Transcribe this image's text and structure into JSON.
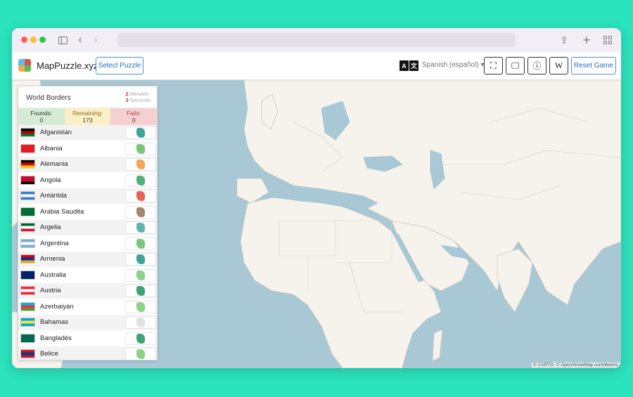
{
  "app": {
    "title": "MapPuzzle.xyz",
    "select_label": "Select Puzzle",
    "lang_glyphs": [
      "A",
      "文"
    ],
    "language": "Spanish (español) ▾",
    "reset_label": "Reset Game",
    "wiki_glyph": "W",
    "info_glyph": "ⓘ",
    "fullscreen_glyph": "⛶",
    "monitor_glyph": "🖵"
  },
  "browser": {
    "back_glyph": "‹",
    "forward_glyph": "›",
    "share_glyph": "⇪",
    "plus_glyph": "+"
  },
  "panel": {
    "title": "World Borders",
    "timer": {
      "minutes": "2",
      "minutes_label": "Minutes",
      "seconds": "3",
      "seconds_label": "Seconds"
    },
    "found_label": "Founds:",
    "found_value": "0",
    "remaining_label": "Remaining:",
    "remaining_value": "173",
    "fails_label": "Fails:",
    "fails_value": "0"
  },
  "countries": [
    {
      "name": "Afganistán",
      "flag": [
        "#000000",
        "#be0000",
        "#007a36"
      ],
      "shape_color": "#3fa39a"
    },
    {
      "name": "Albania",
      "flag": [
        "#e41e20",
        "#e41e20",
        "#e41e20"
      ],
      "shape_color": "#7cc47a"
    },
    {
      "name": "Alemania",
      "flag": [
        "#000000",
        "#dd0000",
        "#ffce00"
      ],
      "shape_color": "#f0a85a"
    },
    {
      "name": "Angola",
      "flag": [
        "#cc092f",
        "#cc092f",
        "#000000"
      ],
      "shape_color": "#52b07e"
    },
    {
      "name": "Antártida",
      "flag": [
        "#3a7dce",
        "#ffffff",
        "#3a7dce"
      ],
      "shape_color": "#e8605a"
    },
    {
      "name": "Arabia Saudita",
      "flag": [
        "#006c35",
        "#006c35",
        "#006c35"
      ],
      "shape_color": "#a4866a"
    },
    {
      "name": "Argelia",
      "flag": [
        "#006233",
        "#ffffff",
        "#d21034"
      ],
      "shape_color": "#5fb3a8"
    },
    {
      "name": "Argentina",
      "flag": [
        "#75aadb",
        "#ffffff",
        "#75aadb"
      ],
      "shape_color": "#7cc47a"
    },
    {
      "name": "Armenia",
      "flag": [
        "#d90012",
        "#0033a0",
        "#f2a800"
      ],
      "shape_color": "#3fa39a"
    },
    {
      "name": "Australia",
      "flag": [
        "#012169",
        "#012169",
        "#012169"
      ],
      "shape_color": "#8fd08a"
    },
    {
      "name": "Austria",
      "flag": [
        "#ed2939",
        "#ffffff",
        "#ed2939"
      ],
      "shape_color": "#3fa37a"
    },
    {
      "name": "Azerbaiyán",
      "flag": [
        "#00b5e2",
        "#ef3340",
        "#509e2f"
      ],
      "shape_color": "#8fd08a"
    },
    {
      "name": "Bahamas",
      "flag": [
        "#00abc9",
        "#fae042",
        "#00abc9"
      ],
      "shape_color": "#e0e0e0"
    },
    {
      "name": "Bangladés",
      "flag": [
        "#006a4e",
        "#006a4e",
        "#006a4e"
      ],
      "shape_color": "#3fa37a"
    },
    {
      "name": "Belice",
      "flag": [
        "#ce1126",
        "#003f87",
        "#ce1126"
      ],
      "shape_color": "#8fd08a"
    }
  ],
  "map": {
    "attribution": "© CARTO, © OpenStreetMap contributors"
  }
}
